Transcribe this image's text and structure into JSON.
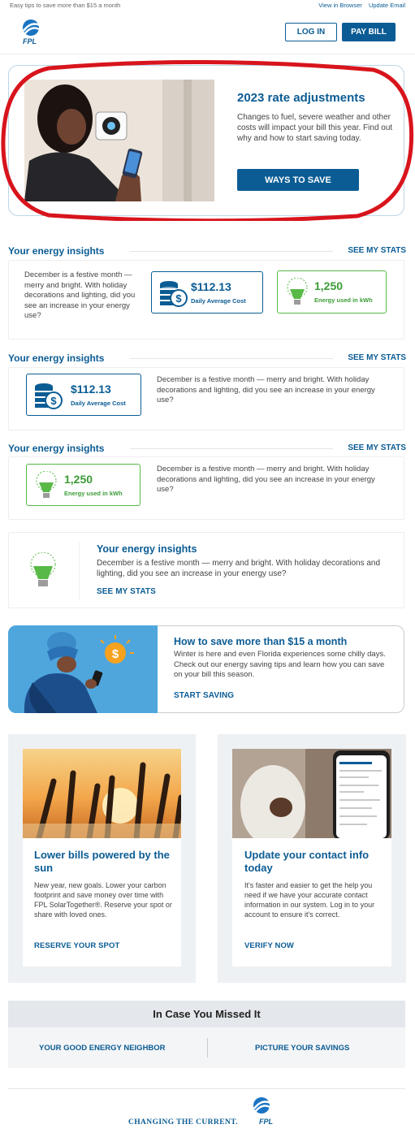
{
  "preheader": {
    "left_text": "Easy tips to save more than $15 a month",
    "view_in_browser": "View in Browser",
    "update_email": "Update Email"
  },
  "header": {
    "logo_text": "FPL",
    "login_label": "LOG IN",
    "paybill_label": "PAY BILL"
  },
  "hero": {
    "title": "2023 rate adjustments",
    "text": "Changes to fuel, severe weather and other costs will impact your bill this year. Find out why and how to start saving today.",
    "cta": "WAYS TO SAVE"
  },
  "insights": {
    "heading": "Your energy insights",
    "link": "SEE MY STATS",
    "text_short": "December is a festive month — merry and bright. With holiday decorations and lighting, did you see an increase in your energy use?",
    "cost_value": "$112.13",
    "cost_label": "Daily Average Cost",
    "kwh_value": "1,250",
    "kwh_label": "Energy used in kWh"
  },
  "save_tip": {
    "title": "How to save more than $15 a month",
    "text": "Winter is here and even Florida experiences some chilly days. Check out our energy saving tips and learn how you can save on your bill this season.",
    "link": "START SAVING"
  },
  "cards": [
    {
      "title": "Lower bills powered by the sun",
      "text": "New year, new goals. Lower your carbon footprint and save money over time with FPL SolarTogether®. Reserve your spot or share with loved ones.",
      "link": "RESERVE YOUR SPOT"
    },
    {
      "title": "Update your contact info today",
      "text": "It's faster and easier to get the help you need if we have your accurate contact information in our system. Log in to your account to ensure it's correct.",
      "link": "VERIFY NOW"
    }
  ],
  "missed": {
    "heading": "In Case You Missed It",
    "left_link": "YOUR GOOD ENERGY NEIGHBOR",
    "right_link": "PICTURE YOUR SAVINGS"
  },
  "footer": {
    "tagline": "CHANGING THE CURRENT.",
    "logo_text": "FPL"
  },
  "colors": {
    "brand_blue": "#0b5c94",
    "green": "#58b947",
    "annotation_red": "#d8141c"
  }
}
